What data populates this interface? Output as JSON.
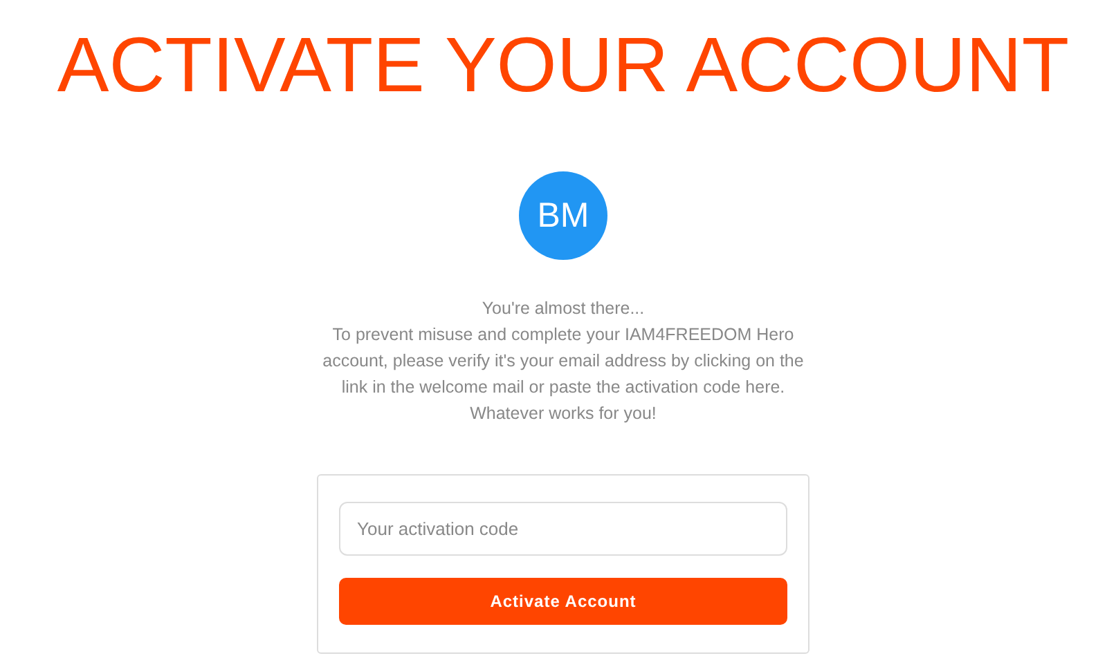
{
  "title": "ACTIVATE YOUR ACCOUNT",
  "avatar": {
    "initials": "BM"
  },
  "intro": "You're almost there...",
  "message": "To prevent misuse and complete your IAM4FREEDOM Hero account, please verify it's your email address by clicking on the link in the welcome mail or paste the activation code here. Whatever works for you!",
  "form": {
    "code_field": {
      "placeholder": "Your activation code"
    },
    "button": "Activate Account"
  }
}
